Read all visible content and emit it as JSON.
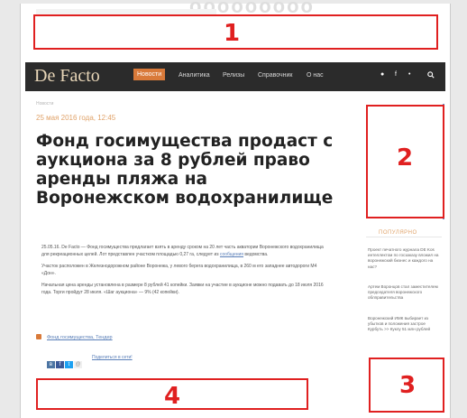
{
  "header": {
    "watermark": "ооооооооо"
  },
  "nav": {
    "logo": "De Facto",
    "items": [
      {
        "label": "Новости"
      },
      {
        "label": "Аналитика"
      },
      {
        "label": "Релизы"
      },
      {
        "label": "Справочник"
      },
      {
        "label": "О нас"
      }
    ],
    "social": [
      "twitter-icon",
      "facebook-icon",
      "vk-icon",
      "search-icon"
    ]
  },
  "article": {
    "breadcrumb": "Новости",
    "date": "25 мая 2016 года, 12:45",
    "title": "Фонд госимущества продаст с аукциона за 8 рублей право аренды пляжа на Воронежском водохранилище",
    "paragraphs": [
      "25.05.16. De Facto — Фонд госимущества предлагает взять в аренду сроком на 20 лет часть акватории Воронежского водохранилища для рекреационных целей. Лот представлен участком площадью 0,27 га, следует из",
      "Участок расположен в Железнодорожном районе Воронежа, у левого берега водохранилища, в 260 м его западнее автодороги М4 «Дон».",
      "Начальная цена аренды установлена в размере 8 рублей 41 копейки. Заявки на участие в аукционе можно подавать до 18 июля 2016 года. Торги пройдут 28 июля. «Шаг аукциона» — 9% (42 копейки)."
    ],
    "paragraph1_link": "сообщения",
    "paragraph1_tail": "ведомства.",
    "tags": "Фонд госимущества, Тендер",
    "share_label": "Поделиться в сети!"
  },
  "sidebar": {
    "popular_title": "ПОПУЛЯРНО",
    "popular_items": [
      "Проект печатного журнала DE Kos интеллектом по госзаказу вложил на воронежский бизнес и каждого на нас?",
      "Артем Воронцов стал заместителем председателя воронежского облправительства",
      "Воронежский ИМК выбирает из убытков и положения застрое Курбуть >> Куклу 51 млн рублей"
    ]
  },
  "annotations": {
    "zone1": "1",
    "zone2": "2",
    "zone3": "3",
    "zone4": "4"
  },
  "colors": {
    "accent": "#d97a3a",
    "nav_bg": "#2b2b2b",
    "annotation": "#e02020",
    "link": "#5a7fb8"
  }
}
